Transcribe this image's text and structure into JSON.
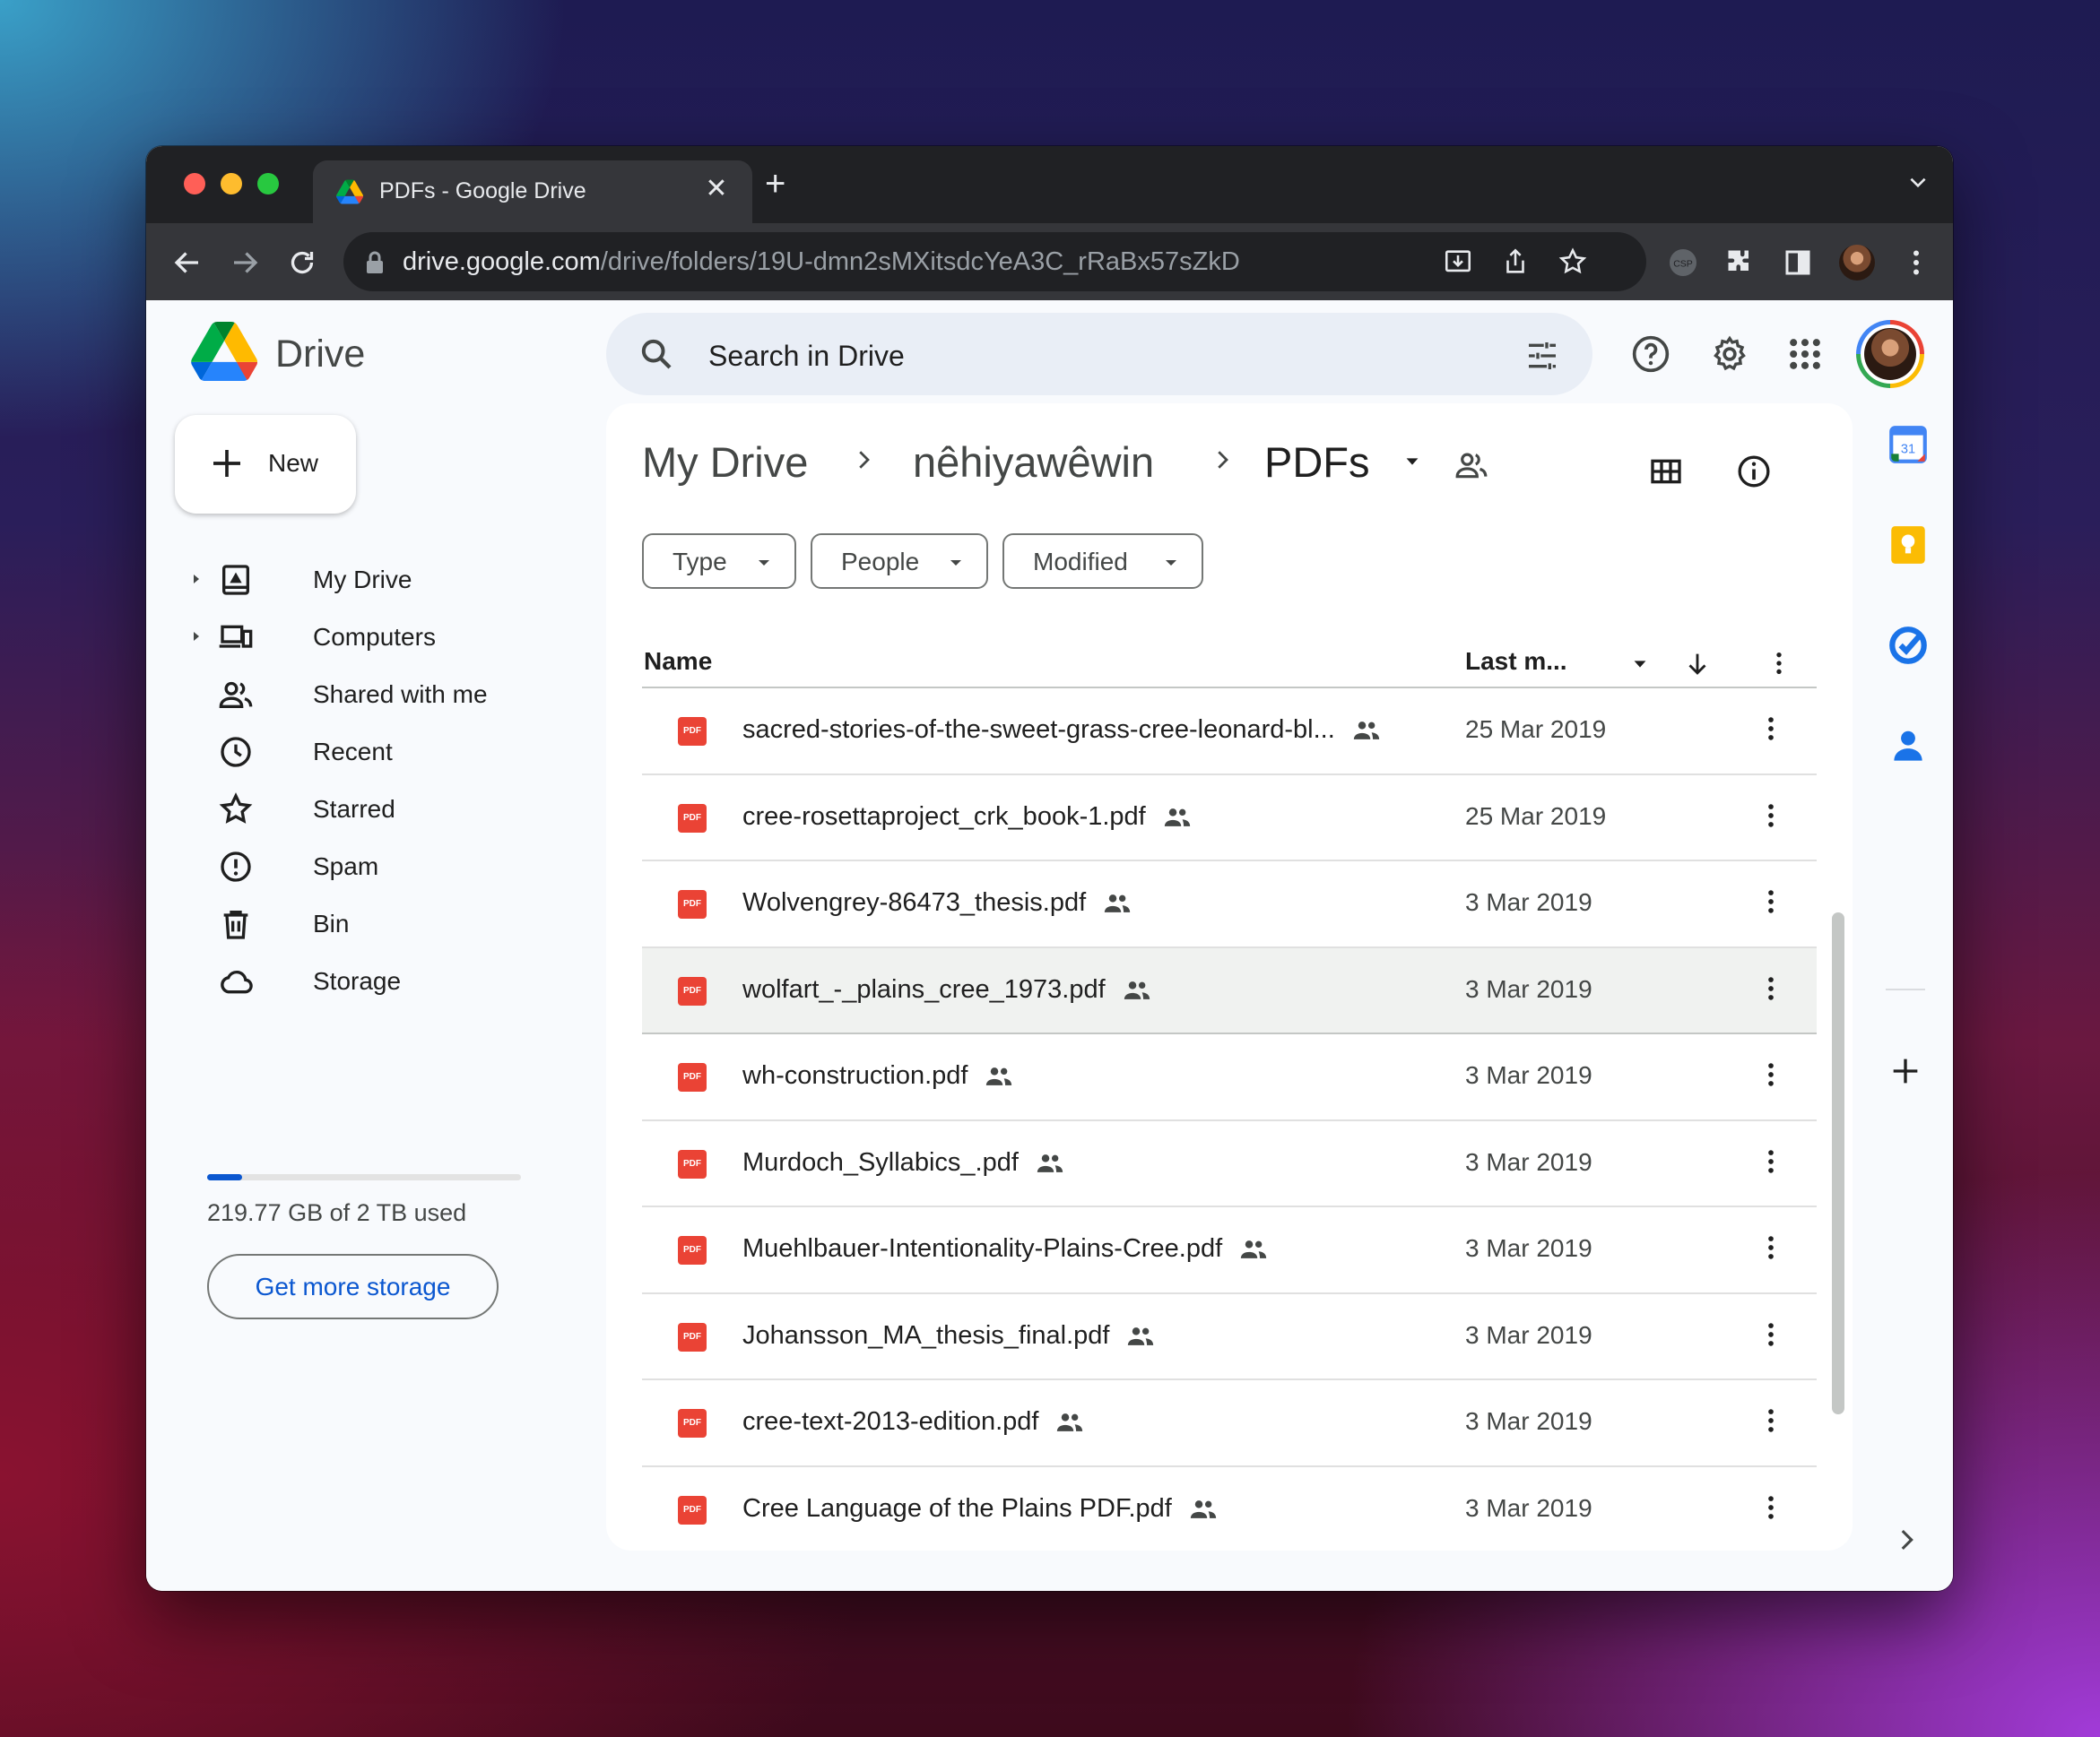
{
  "browser": {
    "tab_title": "PDFs - Google Drive",
    "tab_close": "✕",
    "new_tab": "+",
    "url_host": "drive.google.com",
    "url_path": "/drive/folders/19U-dmn2sMXitsdcYeA3C_rRaBx57sZkD",
    "traffic_lights": [
      "#ff5f57",
      "#febc2e",
      "#28c840"
    ]
  },
  "header": {
    "logo_text": "Drive",
    "search_placeholder": "Search in Drive"
  },
  "sidebar": {
    "new_label": "New",
    "items": [
      {
        "label": "My Drive",
        "icon": "my-drive-icon",
        "expandable": true
      },
      {
        "label": "Computers",
        "icon": "computers-icon",
        "expandable": true
      },
      {
        "label": "Shared with me",
        "icon": "shared-icon",
        "expandable": false
      },
      {
        "label": "Recent",
        "icon": "clock-icon",
        "expandable": false
      },
      {
        "label": "Starred",
        "icon": "star-icon",
        "expandable": false
      },
      {
        "label": "Spam",
        "icon": "spam-icon",
        "expandable": false
      },
      {
        "label": "Bin",
        "icon": "trash-icon",
        "expandable": false
      },
      {
        "label": "Storage",
        "icon": "cloud-icon",
        "expandable": false
      }
    ],
    "storage_used_fraction": 0.11,
    "storage_text": "219.77 GB of 2 TB used",
    "get_storage_label": "Get more storage"
  },
  "main": {
    "breadcrumbs": [
      "My Drive",
      "nêhiyawêwin",
      "PDFs"
    ],
    "filters": [
      "Type",
      "People",
      "Modified"
    ],
    "columns": {
      "name": "Name",
      "modified": "Last m..."
    },
    "files": [
      {
        "name": "sacred-stories-of-the-sweet-grass-cree-leonard-bl...",
        "date": "25 Mar 2019"
      },
      {
        "name": "cree-rosettaproject_crk_book-1.pdf",
        "date": "25 Mar 2019"
      },
      {
        "name": "Wolvengrey-86473_thesis.pdf",
        "date": "3 Mar 2019"
      },
      {
        "name": "wolfart_-_plains_cree_1973.pdf",
        "date": "3 Mar 2019"
      },
      {
        "name": "wh-construction.pdf",
        "date": "3 Mar 2019"
      },
      {
        "name": "Murdoch_Syllabics_.pdf",
        "date": "3 Mar 2019"
      },
      {
        "name": "Muehlbauer-Intentionality-Plains-Cree.pdf",
        "date": "3 Mar 2019"
      },
      {
        "name": "Johansson_MA_thesis_final.pdf",
        "date": "3 Mar 2019"
      },
      {
        "name": "cree-text-2013-edition.pdf",
        "date": "3 Mar 2019"
      },
      {
        "name": "Cree Language of the Plains PDF.pdf",
        "date": "3 Mar 2019"
      }
    ],
    "selected_row": 3,
    "pdf_badge": "PDF"
  },
  "side_panel": {
    "calendar_day": "31"
  }
}
